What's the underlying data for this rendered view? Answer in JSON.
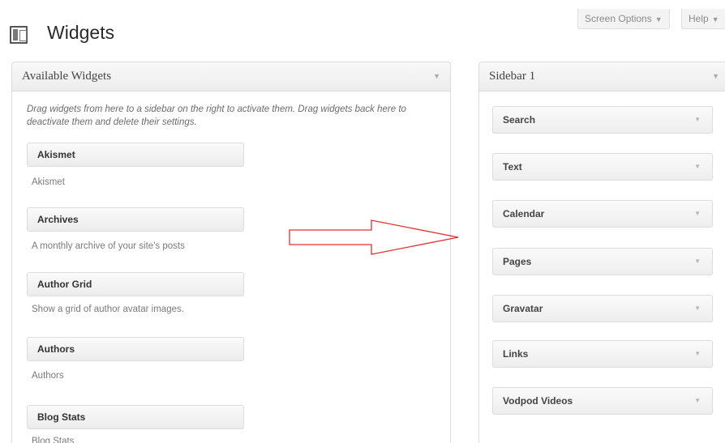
{
  "header": {
    "title": "Widgets",
    "screen_options": "Screen Options",
    "help": "Help",
    "tab_arrow": "▼"
  },
  "available": {
    "title": "Available Widgets",
    "toggle": "▼",
    "description": "Drag widgets from here to a sidebar on the right to activate them. Drag widgets back here to deactivate them and delete their settings.",
    "widgets": [
      {
        "label": "Akismet",
        "desc": "Akismet"
      },
      {
        "label": "Archives",
        "desc": "A monthly archive of your site's posts"
      },
      {
        "label": "Author Grid",
        "desc": "Show a grid of author avatar images."
      },
      {
        "label": "Authors",
        "desc": "Authors"
      },
      {
        "label": "Blog Stats",
        "desc": "Blog Stats"
      }
    ]
  },
  "sidebar": {
    "title": "Sidebar 1",
    "toggle": "▼",
    "widgets": [
      {
        "label": "Search"
      },
      {
        "label": "Text"
      },
      {
        "label": "Calendar"
      },
      {
        "label": "Pages"
      },
      {
        "label": "Gravatar"
      },
      {
        "label": "Links"
      },
      {
        "label": "Vodpod Videos"
      }
    ]
  },
  "annotation": {
    "arrow_color": "#e03030"
  }
}
